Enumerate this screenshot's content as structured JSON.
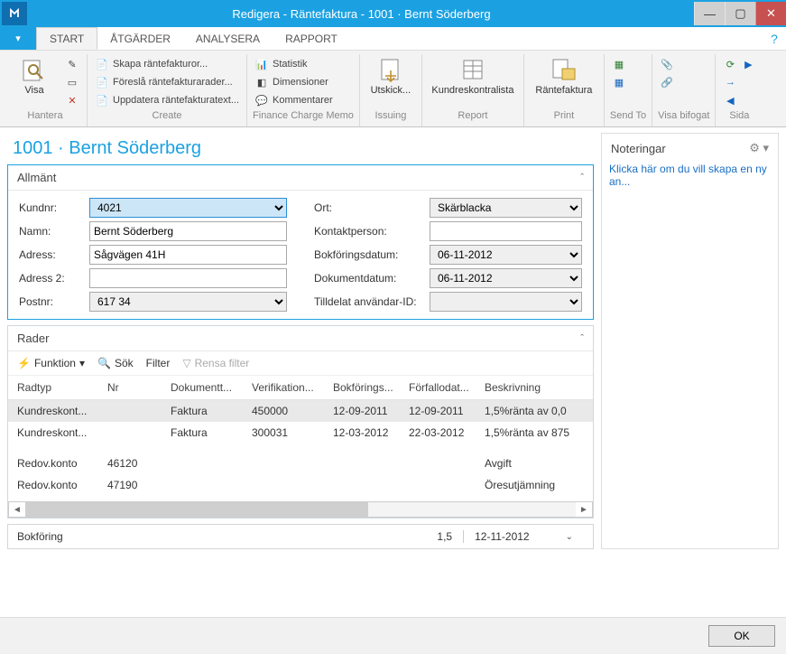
{
  "window": {
    "title": "Redigera - Räntefaktura - 1001 · Bernt Söderberg"
  },
  "menu": {
    "file_marker": "▾",
    "tabs": [
      "START",
      "ÅTGÄRDER",
      "ANALYSERA",
      "RAPPORT"
    ]
  },
  "ribbon": {
    "hantera": {
      "label": "Hantera",
      "visa": "Visa"
    },
    "create": {
      "label": "Create",
      "items": [
        "Skapa räntefakturor...",
        "Föreslå räntefakturarader...",
        "Uppdatera räntefakturatext..."
      ]
    },
    "fcm": {
      "label": "Finance Charge Memo",
      "items": [
        "Statistik",
        "Dimensioner",
        "Kommentarer"
      ]
    },
    "issuing": {
      "label": "Issuing",
      "btn": "Utskick..."
    },
    "report": {
      "label": "Report",
      "btn": "Kundreskontralista"
    },
    "print": {
      "label": "Print",
      "btn": "Räntefaktura"
    },
    "sendto": {
      "label": "Send To"
    },
    "visab": {
      "label": "Visa bifogat"
    },
    "sida": {
      "label": "Sida"
    }
  },
  "page_title": "1001 · Bernt Söderberg",
  "allmant": {
    "title": "Allmänt",
    "kundnr_l": "Kundnr:",
    "kundnr": "4021",
    "namn_l": "Namn:",
    "namn": "Bernt Söderberg",
    "adress_l": "Adress:",
    "adress": "Sågvägen 41H",
    "adress2_l": "Adress 2:",
    "adress2": "",
    "postnr_l": "Postnr:",
    "postnr": "617 34",
    "ort_l": "Ort:",
    "ort": "Skärblacka",
    "kontakt_l": "Kontaktperson:",
    "kontakt": "",
    "bokfd_l": "Bokföringsdatum:",
    "bokfd": "06-11-2012",
    "dokd_l": "Dokumentdatum:",
    "dokd": "06-11-2012",
    "user_l": "Tilldelat användar-ID:",
    "user": ""
  },
  "rader": {
    "title": "Rader",
    "tools": {
      "funktion": "Funktion",
      "sok": "Sök",
      "filter": "Filter",
      "rensa": "Rensa filter"
    },
    "cols": [
      "Radtyp",
      "Nr",
      "Dokumentt...",
      "Verifikation...",
      "Bokförings...",
      "Förfallodat...",
      "Beskrivning"
    ],
    "rows": [
      {
        "r": "Kundreskont...",
        "n": "",
        "d": "Faktura",
        "v": "450000",
        "b": "12-09-2011",
        "f": "12-09-2011",
        "bes": "1,5%ränta av 0,0"
      },
      {
        "r": "Kundreskont...",
        "n": "",
        "d": "Faktura",
        "v": "300031",
        "b": "12-03-2012",
        "f": "22-03-2012",
        "bes": "1,5%ränta av 875"
      },
      {
        "r": "",
        "n": "",
        "d": "",
        "v": "",
        "b": "",
        "f": "",
        "bes": ""
      },
      {
        "r": "Redov.konto",
        "n": "46120",
        "d": "",
        "v": "",
        "b": "",
        "f": "",
        "bes": "Avgift"
      },
      {
        "r": "Redov.konto",
        "n": "47190",
        "d": "",
        "v": "",
        "b": "",
        "f": "",
        "bes": "Öresutjämning"
      }
    ]
  },
  "bokforing": {
    "title": "Bokföring",
    "v1": "1,5",
    "v2": "12-11-2012"
  },
  "noteringar": {
    "title": "Noteringar",
    "link": "Klicka här om du vill skapa en ny an..."
  },
  "footer": {
    "ok": "OK"
  }
}
